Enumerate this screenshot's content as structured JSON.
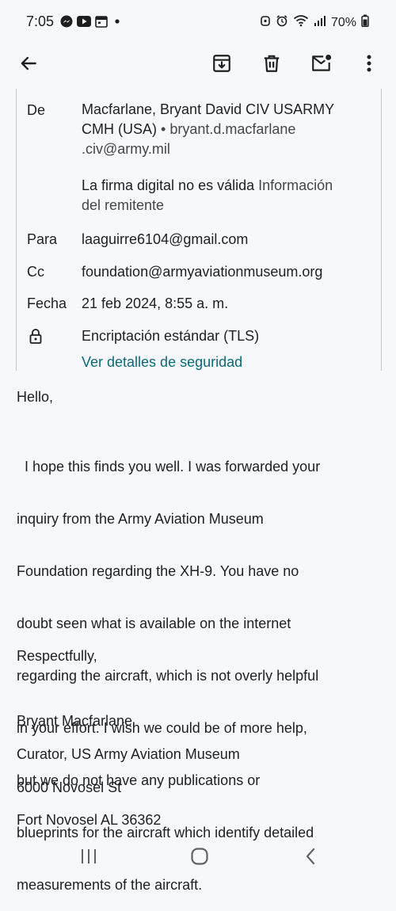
{
  "status": {
    "time": "7:05",
    "battery": "70%"
  },
  "details": {
    "from_label": "De",
    "from_name_line1": "Macfarlane, Bryant David CIV USARMY",
    "from_name_line2": "CMH (USA)",
    "from_sep": " • ",
    "from_email_part1": "bryant.d.macfarlane",
    "from_email_part2": ".civ@army.mil",
    "signature_invalid": "La firma digital no es válida",
    "sender_info_part1": "Información",
    "sender_info_part2": "del remitente",
    "to_label": "Para",
    "to_value": "laaguirre6104@gmail.com",
    "cc_label": "Cc",
    "cc_value": "foundation@armyaviationmuseum.org",
    "date_label": "Fecha",
    "date_value": "21 feb 2024, 8:55 a. m.",
    "encryption": "Encriptación estándar (TLS)",
    "security_link": "Ver detalles de seguridad"
  },
  "message": {
    "greeting": "Hello,",
    "para_lines": [
      "  I hope this finds you well. I was forwarded your",
      "inquiry from the Army Aviation Museum",
      "Foundation regarding the XH-9. You have no",
      "doubt seen what is available on the internet",
      "regarding the aircraft, which is not overly helpful",
      "in your effort. I wish we could be of more help,",
      "but we do not have any publications or",
      "blueprints for the aircraft which identify detailed",
      "measurements of the aircraft."
    ],
    "closing": "Respectfully,",
    "sig_name": "Bryant Macfarlane",
    "sig_title": "Curator, US Army Aviation Museum",
    "sig_street": "6000 Novosel St",
    "sig_city": "Fort Novosel AL 36362"
  },
  "icons": {
    "back": "arrow-left-icon",
    "archive": "archive-icon",
    "delete": "trash-icon",
    "mark_unread": "mail-unread-icon",
    "more": "more-vert-icon"
  }
}
